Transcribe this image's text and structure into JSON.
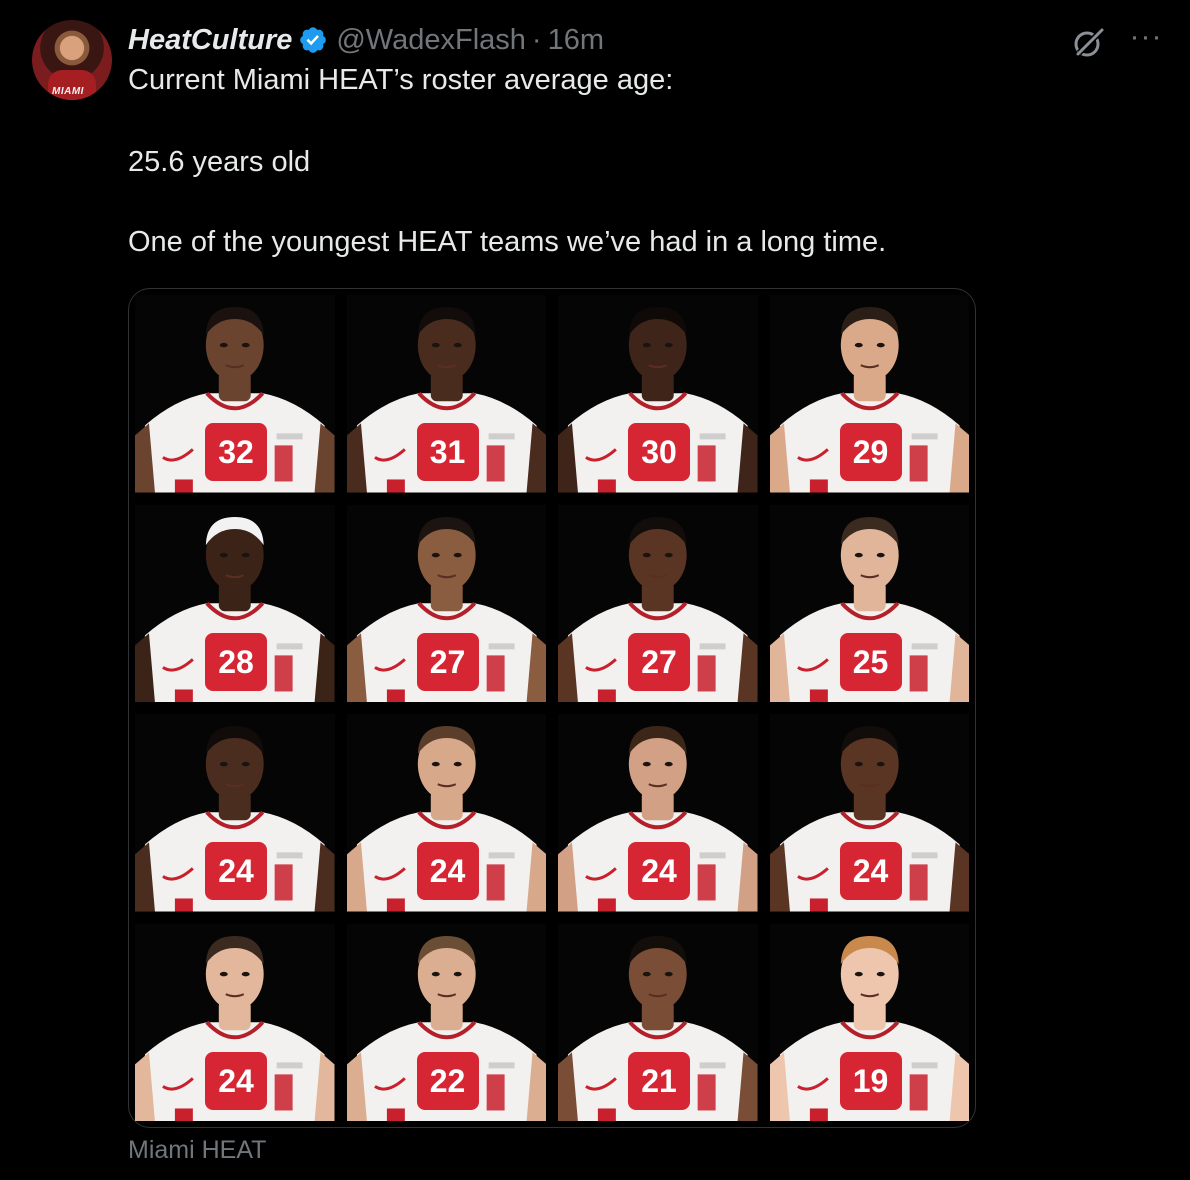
{
  "colors": {
    "background": "#000000",
    "text_primary": "#e7e9ea",
    "text_secondary": "#71767b",
    "verified_blue": "#1d9bf0",
    "badge_red": "#d62633",
    "media_border": "#2f3336"
  },
  "author": {
    "display_name": "HeatCulture",
    "handle": "@WadexFlash",
    "separator": "·",
    "time": "16m",
    "avatar_icon": "profile-avatar",
    "avatar_text": "MIAMI",
    "verified_icon": "verified-badge-icon"
  },
  "actions": {
    "grok_icon": "grok-icon",
    "more_label": "···"
  },
  "tweet": {
    "line1": "Current Miami HEAT’s roster average age:",
    "line2": "25.6 years old",
    "line3": "One of the youngest HEAT teams we’ve had in a long time."
  },
  "media": {
    "players": [
      {
        "age": "32",
        "skin": "#6b4430",
        "hair": "#1b1210"
      },
      {
        "age": "31",
        "skin": "#4a2c1f",
        "hair": "#120c0a"
      },
      {
        "age": "30",
        "skin": "#3f2519",
        "hair": "#0f0a08"
      },
      {
        "age": "29",
        "skin": "#d9a989",
        "hair": "#2a1e17"
      },
      {
        "age": "28",
        "skin": "#3b2318",
        "hair": "#f2f2f2"
      },
      {
        "age": "27",
        "skin": "#8a5c40",
        "hair": "#1c1410"
      },
      {
        "age": "27",
        "skin": "#5a3524",
        "hair": "#120c0a"
      },
      {
        "age": "25",
        "skin": "#e0b59a",
        "hair": "#3a2a1f"
      },
      {
        "age": "24",
        "skin": "#4b2d1f",
        "hair": "#110b09"
      },
      {
        "age": "24",
        "skin": "#d7a88a",
        "hair": "#5a3e2a"
      },
      {
        "age": "24",
        "skin": "#d2a084",
        "hair": "#3b2618"
      },
      {
        "age": "24",
        "skin": "#5a3524",
        "hair": "#120c0a"
      },
      {
        "age": "24",
        "skin": "#e3b79c",
        "hair": "#3a2a20"
      },
      {
        "age": "22",
        "skin": "#dcae91",
        "hair": "#6a4d35"
      },
      {
        "age": "21",
        "skin": "#7a4e36",
        "hair": "#140e0b"
      },
      {
        "age": "19",
        "skin": "#eec6ad",
        "hair": "#c9884c"
      }
    ],
    "caption": "Miami HEAT"
  }
}
